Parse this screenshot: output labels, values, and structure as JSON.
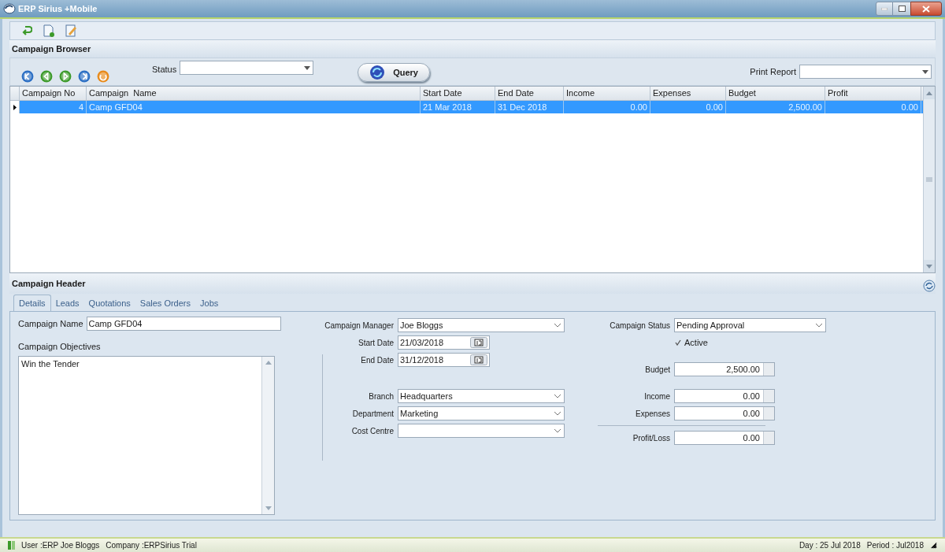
{
  "window": {
    "title": "ERP Sirius +Mobile"
  },
  "browser": {
    "title": "Campaign Browser",
    "status_filter": {
      "label": "Status"
    },
    "query_button": "Query",
    "print_report": {
      "label": "Print Report"
    }
  },
  "table": {
    "columns": [
      {
        "label": "Campaign No",
        "kind": "number"
      },
      {
        "label": "Campaign  Name",
        "kind": "text"
      },
      {
        "label": "Start Date",
        "kind": "text"
      },
      {
        "label": "End Date",
        "kind": "text"
      },
      {
        "label": "Income",
        "kind": "number"
      },
      {
        "label": "Expenses",
        "kind": "number"
      },
      {
        "label": "Budget",
        "kind": "number"
      },
      {
        "label": "Profit",
        "kind": "number"
      }
    ],
    "rows": [
      {
        "selected": true,
        "cells": [
          "4",
          "Camp GFD04",
          "21 Mar 2018",
          "31 Dec 2018",
          "0.00",
          "0.00",
          "2,500.00",
          "0.00"
        ]
      }
    ]
  },
  "header": {
    "title": "Campaign Header",
    "tabs": [
      {
        "label": "Details",
        "selected": true
      },
      {
        "label": "Leads",
        "selected": false
      },
      {
        "label": "Quotations",
        "selected": false
      },
      {
        "label": "Sales Orders",
        "selected": false
      },
      {
        "label": "Jobs",
        "selected": false
      }
    ],
    "campaign_name": {
      "label": "Campaign Name",
      "value": "Camp GFD04"
    },
    "objectives": {
      "label": "Campaign Objectives",
      "value": "Win the Tender"
    },
    "middle_groups": [
      [
        {
          "kind": "select",
          "label": "Campaign Manager",
          "value": "Joe Bloggs"
        },
        {
          "kind": "date",
          "label": "Start Date",
          "value": "21/03/2018"
        },
        {
          "kind": "date",
          "label": "End Date",
          "value": "31/12/2018"
        }
      ],
      [
        {
          "kind": "select",
          "label": "Branch",
          "value": "Headquarters"
        },
        {
          "kind": "select",
          "label": "Department",
          "value": "Marketing"
        },
        {
          "kind": "select",
          "label": "Cost Centre"
        }
      ]
    ],
    "right_groups": [
      [
        {
          "kind": "select",
          "label": "Campaign Status",
          "value": "Pending Approval"
        },
        {
          "kind": "checkbox",
          "label": "Active",
          "checked": true
        }
      ],
      [
        {
          "kind": "amount",
          "label": "Budget",
          "value": "2,500.00"
        }
      ],
      [
        {
          "kind": "amount",
          "label": "Income",
          "value": "0.00"
        },
        {
          "kind": "amount",
          "label": "Expenses",
          "value": "0.00"
        }
      ],
      [
        {
          "kind": "amount",
          "label": "Profit/Loss",
          "value": "0.00"
        }
      ]
    ]
  },
  "status_bar": {
    "user": "User :ERP Joe Bloggs",
    "company": "Company :ERPSirius Trial",
    "day": "Day : 25 Jul 2018",
    "period": "Period : Jul2018"
  }
}
